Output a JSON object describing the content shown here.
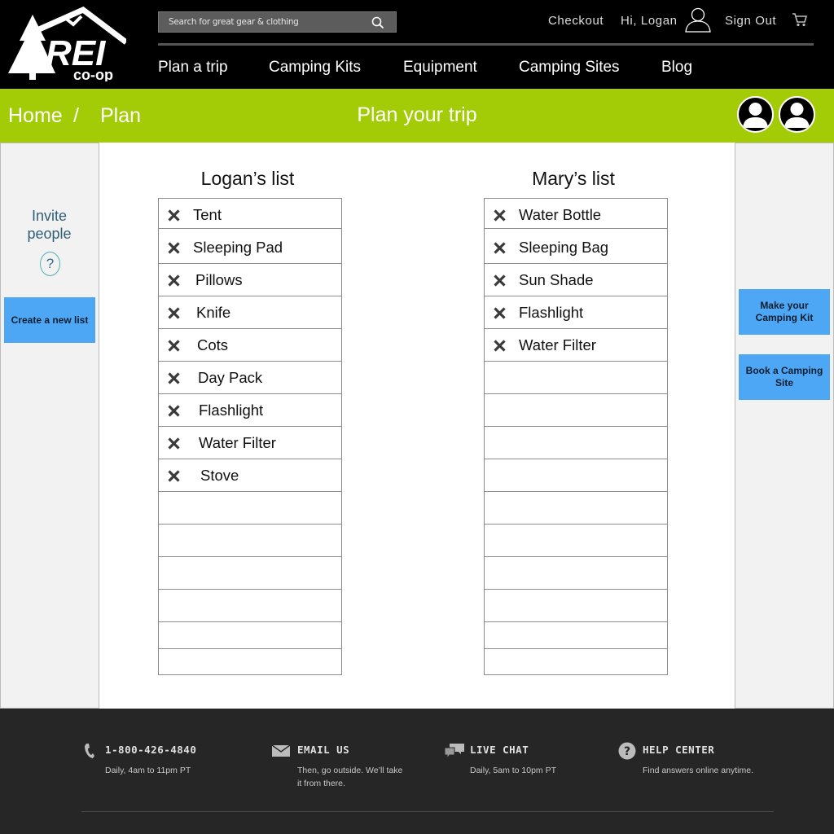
{
  "brand": {
    "logo_text_top": "REI",
    "logo_text_bottom": "co-op"
  },
  "header": {
    "search_placeholder": "Search for great gear & clothing",
    "checkout": "Checkout",
    "greeting": "Hi, Logan",
    "sign_out": "Sign Out",
    "nav": [
      "Plan a trip",
      "Camping Kits",
      "Equipment",
      "Camping Sites",
      "Blog"
    ]
  },
  "breadcrumb": {
    "home": "Home",
    "separator": "/",
    "current": "Plan"
  },
  "page_title": "Plan your trip",
  "left_panel": {
    "invite_line1": "Invite",
    "invite_line2": "people",
    "help": "?",
    "create_list_button": "Create a new list"
  },
  "right_panel": {
    "camping_kit_button": "Make your Camping Kit",
    "camping_site_button": "Book a Camping Site"
  },
  "lists": [
    {
      "title": "Logan’s list",
      "items": [
        "Tent",
        "Sleeping Pad",
        "Pillows",
        "Knife",
        "Cots",
        "Day Pack",
        "Flashlight",
        "Water Filter",
        "Stove"
      ]
    },
    {
      "title": "Mary’s list",
      "items": [
        "Water Bottle",
        "Sleeping Bag",
        "Sun Shade",
        "Flashlight",
        "Water Filter"
      ]
    }
  ],
  "footer": {
    "phone": {
      "title": "1-800-426-4840",
      "sub": "Daily, 4am to 11pm PT"
    },
    "email": {
      "title": "EMAIL US",
      "sub_line1": "Then, go outside. We’ll take",
      "sub_line2": "it from there."
    },
    "chat": {
      "title": "LIVE CHAT",
      "sub": "Daily, 5am to 10pm PT"
    },
    "help": {
      "title": "HELP CENTER",
      "sub": "Find answers online anytime."
    }
  },
  "colors": {
    "accent_green": "#a3cb06",
    "button_blue": "#4da7f5",
    "header_bg": "#000000",
    "footer_bg": "#262626"
  }
}
